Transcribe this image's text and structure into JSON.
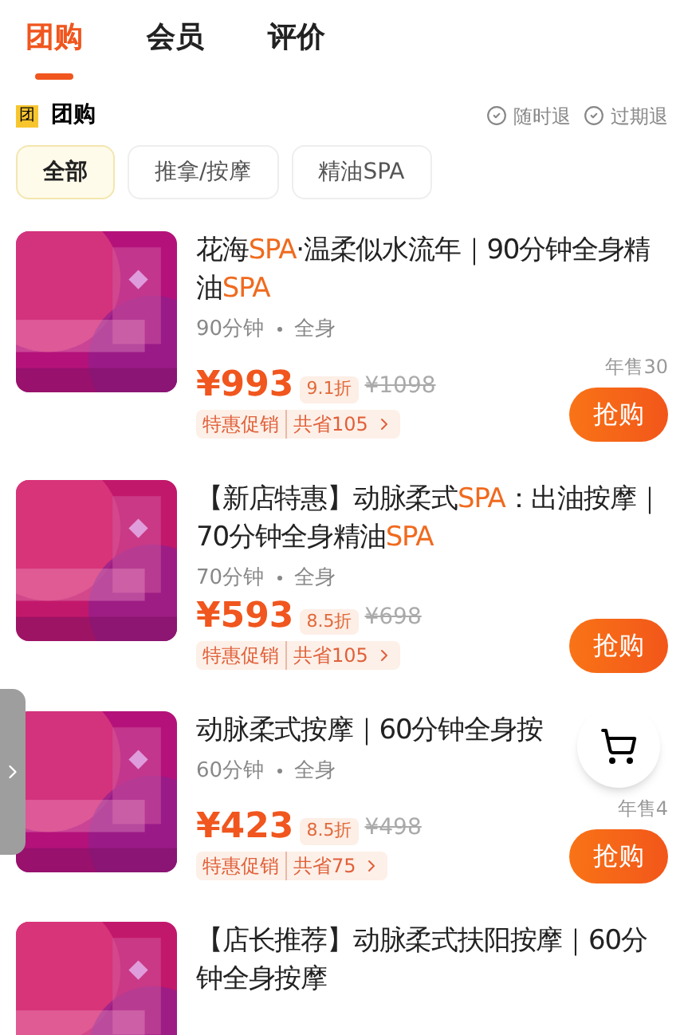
{
  "tabs": [
    {
      "label": "团购",
      "selected": true
    },
    {
      "label": "会员",
      "selected": false
    },
    {
      "label": "评价",
      "selected": false
    }
  ],
  "section": {
    "badge": "团",
    "title": "团购",
    "guarantees": [
      "随时退",
      "过期退"
    ]
  },
  "filters": [
    {
      "label": "全部",
      "selected": true
    },
    {
      "label": "推拿/按摩",
      "selected": false
    },
    {
      "label": "精油SPA",
      "selected": false
    }
  ],
  "deals": [
    {
      "title": [
        {
          "text": "花海"
        },
        {
          "text": "SPA",
          "highlight": true
        },
        {
          "text": "·温柔似水流年｜90分钟全身精油"
        },
        {
          "text": "SPA",
          "highlight": true
        }
      ],
      "duration": "90分钟",
      "area": "全身",
      "price": "¥993",
      "discount": "9.1折",
      "original": "¥1098",
      "promo": "特惠促销",
      "savings": "共省105",
      "sold": "年售30",
      "button": "抢购"
    },
    {
      "title": [
        {
          "text": "【新店特惠】动脉柔式"
        },
        {
          "text": "SPA",
          "highlight": true
        },
        {
          "text": "：出油按摩｜70分钟全身精油"
        },
        {
          "text": "SPA",
          "highlight": true
        }
      ],
      "duration": "70分钟",
      "area": "全身",
      "price": "¥593",
      "discount": "8.5折",
      "original": "¥698",
      "promo": "特惠促销",
      "savings": "共省105",
      "button": "抢购"
    },
    {
      "title": [
        {
          "text": "动脉柔式按摩｜60分钟全身按"
        }
      ],
      "duration": "60分钟",
      "area": "全身",
      "price": "¥423",
      "discount": "8.5折",
      "original": "¥498",
      "promo": "特惠促销",
      "savings": "共省75",
      "sold": "年售4",
      "button": "抢购"
    },
    {
      "title": [
        {
          "text": "【店长推荐】动脉柔式扶阳按摩｜60分钟全身按摩"
        }
      ]
    }
  ]
}
